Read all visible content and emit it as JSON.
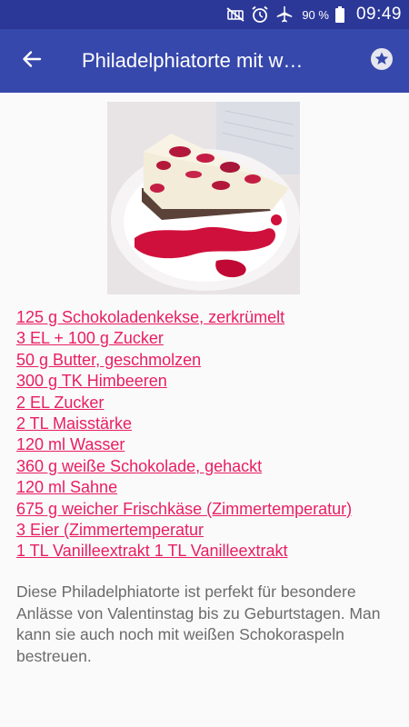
{
  "status_bar": {
    "battery_percent": "90 %",
    "time": "09:49",
    "icons": [
      "mute-icon",
      "alarm-icon",
      "airplane-mode-icon",
      "battery-icon"
    ]
  },
  "app_bar": {
    "title": "Philadelphiatorte mit w…",
    "back_icon": "arrow-back-icon",
    "favorite_icon": "star-icon"
  },
  "recipe_image": {
    "alt": "Philadelphiatorte"
  },
  "ingredients": [
    "125 g Schokoladenkekse, zerkrümelt",
    "3 EL + 100 g Zucker",
    "50 g Butter, geschmolzen",
    "300 g TK Himbeeren",
    "2 EL Zucker",
    "2 TL Maisstärke",
    "120 ml Wasser",
    "360 g weiße Schokolade, gehackt",
    "120 ml Sahne",
    "675 g weicher Frischkäse (Zimmertemperatur)",
    "3 Eier (Zimmertemperatur",
    "1 TL Vanilleextrakt 1 TL Vanilleextrakt"
  ],
  "description": "Diese Philadelphiatorte ist perfekt für besondere Anlässe von Valentinstag bis zu Geburtstagen. Man kann sie auch noch mit weißen Schokoraspeln bestreuen.",
  "colors": {
    "status_bar": "#2c3898",
    "app_bar": "#3748ac",
    "link": "#e91e63",
    "body_text": "#6b6b6b",
    "background": "#fafafa"
  }
}
